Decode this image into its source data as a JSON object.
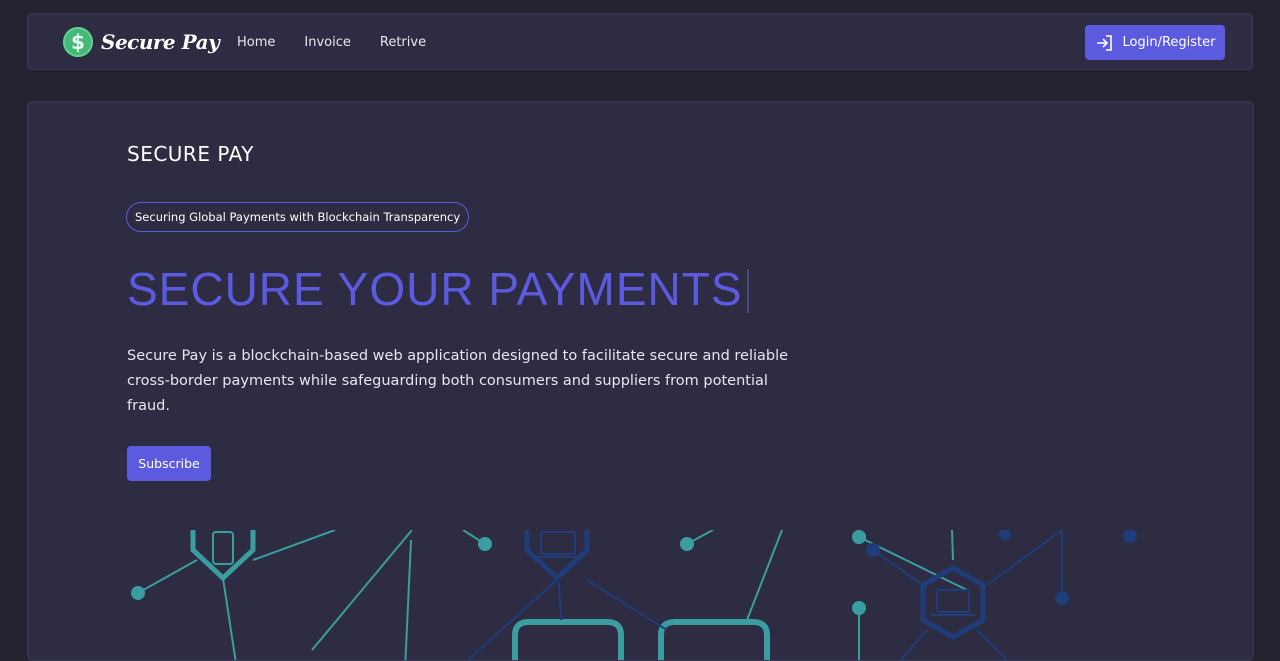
{
  "nav": {
    "brand": "Secure Pay",
    "logo_icon": "dollar-coin-icon",
    "links": [
      "Home",
      "Invoice",
      "Retrive"
    ],
    "login_label": "Login/Register",
    "login_icon": "login-arrow-icon"
  },
  "hero": {
    "eyebrow": "SECURE PAY",
    "tagline": "Securing Global Payments with Blockchain Transparency",
    "headline": "SECURE YOUR PAYMENTS",
    "description": "Secure Pay is a blockchain-based web application designed to facilitate secure and reliable cross-border payments while safeguarding both consumers and suppliers from potential fraud.",
    "subscribe_label": "Subscribe",
    "illustration": "blockchain-network-illustration"
  },
  "colors": {
    "background": "#23222f",
    "panel": "#2d2c42",
    "accent": "#5c5be0",
    "teal": "#3a9ea0",
    "navy": "#1f3d7a"
  }
}
